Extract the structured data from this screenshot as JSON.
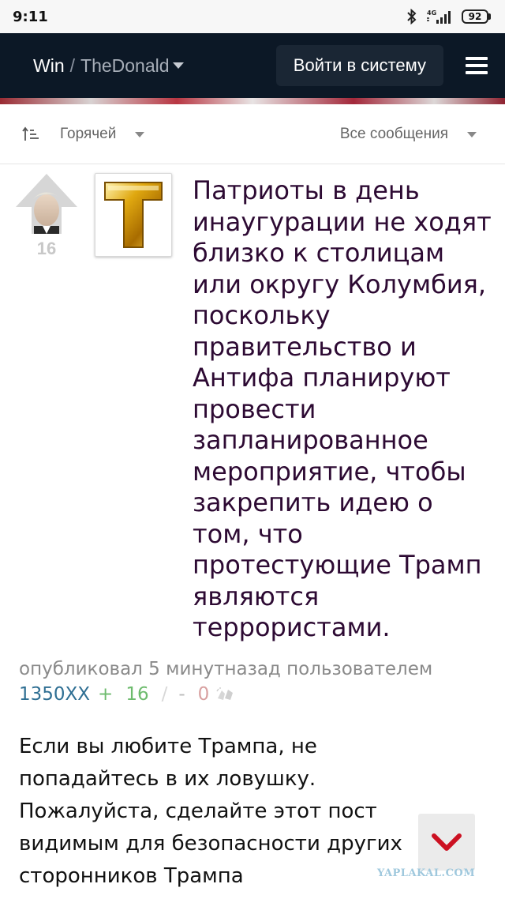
{
  "status_bar": {
    "time": "9:11",
    "network": "4G",
    "battery": "92",
    "icons": [
      "bluetooth-icon",
      "signal-icon",
      "battery-icon"
    ]
  },
  "header": {
    "brand": "Win",
    "separator": "/",
    "community": "TheDonald",
    "login_label": "Войти в систему",
    "menu_icon": "hamburger-menu-icon",
    "background": "#0c1826"
  },
  "sort_bar": {
    "sort_label": "Горячей",
    "filter_label": "Все сообщения",
    "sort_icon": "sort-ascending-icon"
  },
  "post": {
    "score": "16",
    "vote_icon": "upvote-arrow-icon",
    "thumbnail_icon": "gold-letter-t-icon",
    "title": "Патриоты в день инаугурации не ходят близко к столицам или округу Колумбия, поскольку правительство и Антифа планируют провести запланированное мероприятие, чтобы закрепить идею о том, что протестующие Трамп являются террористами.",
    "meta_prefix": "опубликовал 5 минутназад пользователем",
    "author": "1350XX",
    "plus": "+",
    "upvotes": "16",
    "slash": "/",
    "minus": "-",
    "downvotes": "0",
    "award_icon": "clapping-hands-icon",
    "body": "Если вы любите Трампа, не попадайтесь в их ловушку. Пожалуйста, сделайте этот пост видимым для безопасности других сторонников Трампа"
  },
  "scroll_down_icon": "chevron-down-icon",
  "watermark": "YAPLAKAL.COM",
  "colors": {
    "title": "#2d0a33",
    "author": "#2f6f93",
    "upvote": "#6dbb6d",
    "downvote": "#d8a0a0",
    "chevron": "#cc1122"
  }
}
